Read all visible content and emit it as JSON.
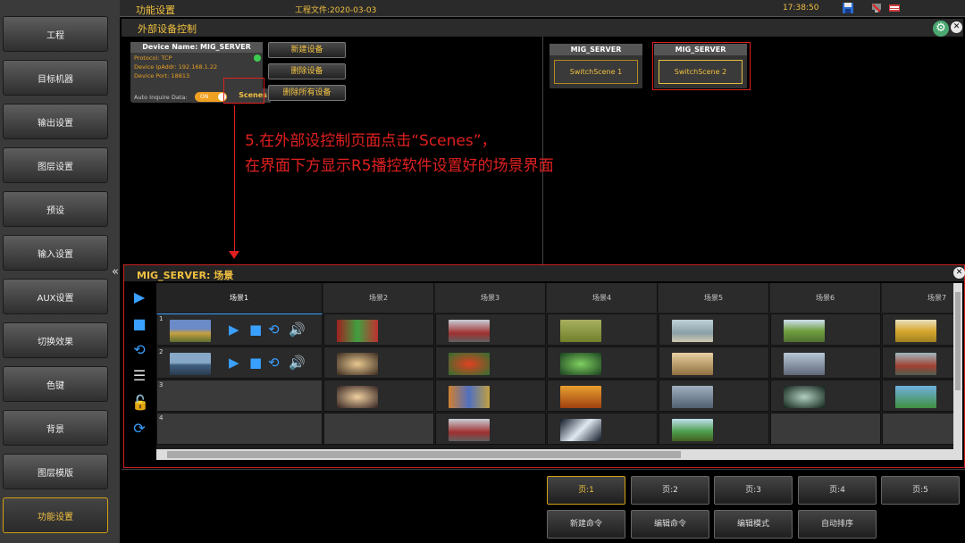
{
  "sidebar": {
    "items": [
      {
        "label": "工程"
      },
      {
        "label": "目标机器"
      },
      {
        "label": "输出设置"
      },
      {
        "label": "图层设置"
      },
      {
        "label": "预设"
      },
      {
        "label": "输入设置"
      },
      {
        "label": "AUX设置"
      },
      {
        "label": "切换效果"
      },
      {
        "label": "色键"
      },
      {
        "label": "背景"
      },
      {
        "label": "图层模版"
      },
      {
        "label": "功能设置"
      }
    ],
    "collapse_glyph": "«"
  },
  "topbar": {
    "title": "功能设置",
    "project": "工程文件:2020-03-03",
    "clock": "17:38:50"
  },
  "section": {
    "title": "外部设备控制"
  },
  "device": {
    "name_label": "Device Name: MIG_SERVER",
    "protocol": "Protocol: TCP",
    "ip": "Device IpAddr: 192.168.1.22",
    "port": "Device Port: 18813",
    "auto_inquire": "Auto Inquire Data:",
    "toggle_label": "ON",
    "scenes_label": "Scenes"
  },
  "device_buttons": {
    "new": "新建设备",
    "delete": "删除设备",
    "delete_all": "删除所有设备"
  },
  "switch_cards": [
    {
      "header": "MIG_SERVER",
      "button": "SwitchScene 1"
    },
    {
      "header": "MIG_SERVER",
      "button": "SwitchScene 2"
    }
  ],
  "annotation": {
    "line1": "5.在外部设控制页面点击“Scenes”，",
    "line2": "在界面下方显示R5播控软件设置好的场景界面"
  },
  "scene_panel": {
    "title": "MIG_SERVER: 场景",
    "columns": [
      "场景1",
      "场景2",
      "场景3",
      "场景4",
      "场景5",
      "场景6",
      "场景7"
    ],
    "row_numbers": [
      "1",
      "2",
      "3",
      "4"
    ]
  },
  "pages": [
    "页:1",
    "页:2",
    "页:3",
    "页:4",
    "页:5"
  ],
  "commands": [
    "新建命令",
    "编辑命令",
    "编辑模式",
    "自动排序"
  ],
  "colors": {
    "accent": "#f0c040",
    "highlight_red": "#e02020",
    "control_blue": "#3aa0ff"
  }
}
